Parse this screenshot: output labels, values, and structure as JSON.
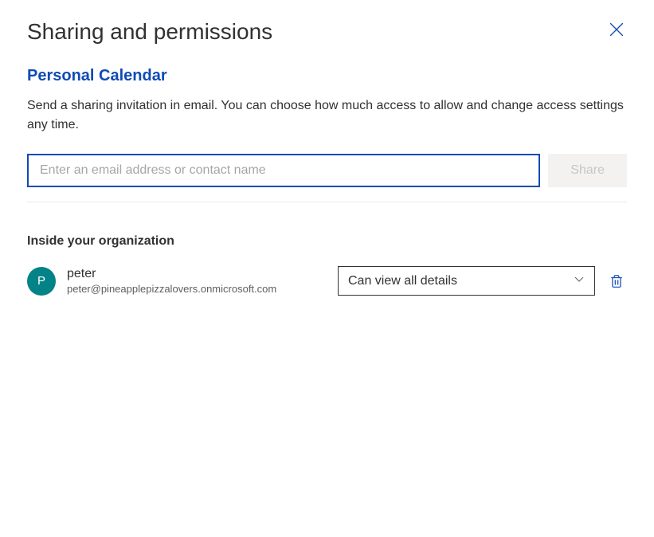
{
  "header": {
    "title": "Sharing and permissions"
  },
  "subtitle": "Personal Calendar",
  "description": "Send a sharing invitation in email. You can choose how much access to allow and change access settings any time.",
  "input": {
    "placeholder": "Enter an email address or contact name",
    "value": ""
  },
  "share_button": "Share",
  "section_title": "Inside your organization",
  "people": [
    {
      "avatar_initial": "P",
      "name": "peter",
      "email": "peter@pineapplepizzalovers.onmicrosoft.com",
      "permission": "Can view all details"
    }
  ],
  "colors": {
    "accent": "#0f4bb5",
    "avatar_bg": "#038387"
  }
}
